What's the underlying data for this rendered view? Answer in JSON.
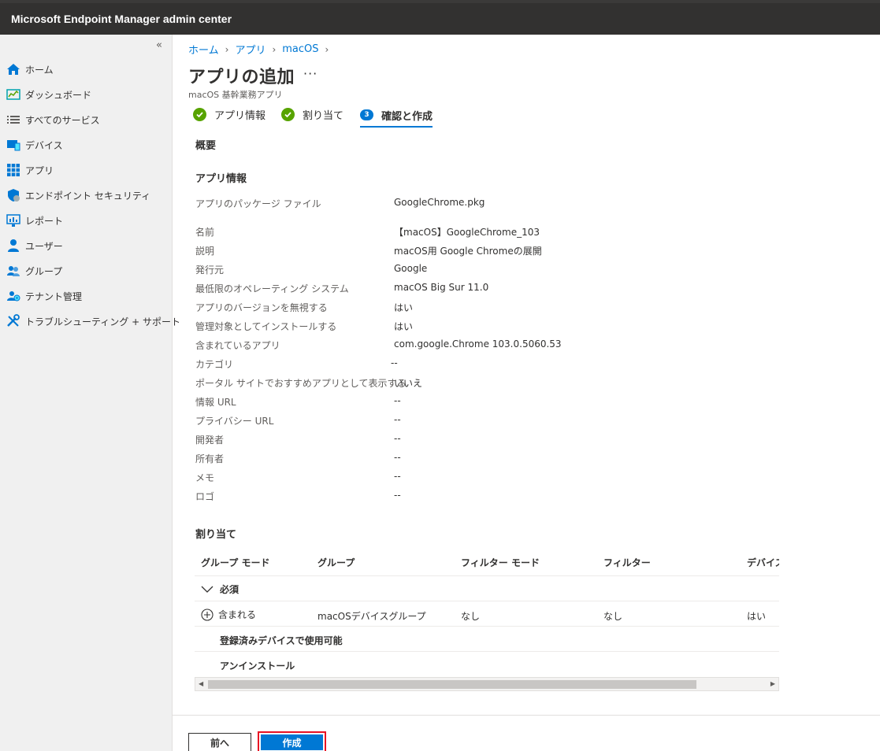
{
  "header": {
    "title": "Microsoft Endpoint Manager admin center"
  },
  "sidebar": {
    "collapse_glyph": "«",
    "items": [
      {
        "label": "ホーム",
        "icon": "home-icon"
      },
      {
        "label": "ダッシュボード",
        "icon": "dashboard-icon"
      },
      {
        "label": "すべてのサービス",
        "icon": "list-icon"
      },
      {
        "label": "デバイス",
        "icon": "devices-icon"
      },
      {
        "label": "アプリ",
        "icon": "apps-grid-icon"
      },
      {
        "label": "エンドポイント セキュリティ",
        "icon": "shield-icon"
      },
      {
        "label": "レポート",
        "icon": "reports-icon"
      },
      {
        "label": "ユーザー",
        "icon": "user-icon"
      },
      {
        "label": "グループ",
        "icon": "group-icon"
      },
      {
        "label": "テナント管理",
        "icon": "tenant-gear-icon"
      },
      {
        "label": "トラブルシューティング + サポート",
        "icon": "wrench-icon"
      }
    ]
  },
  "breadcrumb": [
    "ホーム",
    "アプリ",
    "macOS"
  ],
  "page": {
    "title": "アプリの追加",
    "more": "···",
    "subtitle": "macOS 基幹業務アプリ"
  },
  "steps": [
    {
      "label": "アプリ情報",
      "state": "done"
    },
    {
      "label": "割り当て",
      "state": "done"
    },
    {
      "label": "確認と作成",
      "state": "active",
      "number": "3"
    }
  ],
  "summary": {
    "overview_heading": "概要",
    "app_info_heading": "アプリ情報",
    "package_label": "アプリのパッケージ ファイル",
    "package_value": "GoogleChrome.pkg",
    "fields": [
      {
        "label": "名前",
        "value": "【macOS】GoogleChrome_103"
      },
      {
        "label": "説明",
        "value": "macOS用 Google Chromeの展開"
      },
      {
        "label": "発行元",
        "value": "Google"
      },
      {
        "label": "最低限のオペレーティング システム",
        "value": "macOS Big Sur 11.0"
      },
      {
        "label": "アプリのバージョンを無視する",
        "value": "はい"
      },
      {
        "label": "管理対象としてインストールする",
        "value": "はい"
      },
      {
        "label": "含まれているアプリ",
        "value": "com.google.Chrome 103.0.5060.53"
      },
      {
        "label": "カテゴリ",
        "value": "--"
      },
      {
        "label": "ポータル サイトでおすすめアプリとして表示する",
        "value": "いいえ"
      },
      {
        "label": "情報 URL",
        "value": "--"
      },
      {
        "label": "プライバシー URL",
        "value": "--"
      },
      {
        "label": "開発者",
        "value": "--"
      },
      {
        "label": "所有者",
        "value": "--"
      },
      {
        "label": "メモ",
        "value": "--"
      },
      {
        "label": "ロゴ",
        "value": "--"
      }
    ]
  },
  "assignments": {
    "heading": "割り当て",
    "columns": [
      "グループ モード",
      "グループ",
      "フィルター モード",
      "フィルター",
      "デバイス"
    ],
    "required_label": "必須",
    "row": {
      "mode": "含まれる",
      "group": "macOSデバイスグループ",
      "filter_mode": "なし",
      "filter": "なし",
      "device": "はい"
    },
    "available_label": "登録済みデバイスで使用可能",
    "uninstall_label": "アンインストール"
  },
  "footer": {
    "prev_label": "前へ",
    "create_label": "作成"
  },
  "colors": {
    "accent": "#0078d4",
    "success": "#57a300",
    "highlight": "#e81123"
  }
}
